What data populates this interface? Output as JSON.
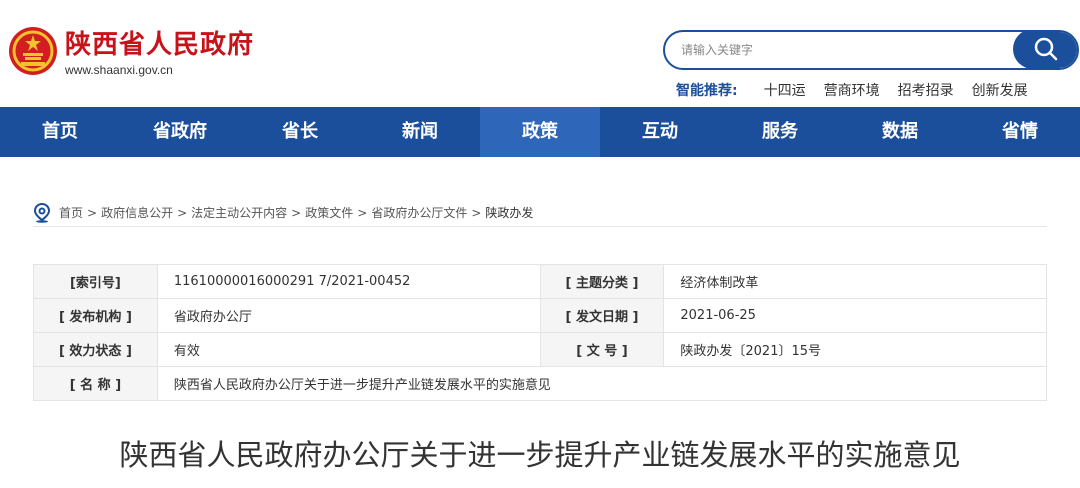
{
  "header": {
    "site_name": "陕西省人民政府",
    "site_url": "www.shaanxi.gov.cn",
    "search_placeholder": "请输入关键字",
    "recommend_label": "智能推荐:",
    "recommend_items": [
      "十四运",
      "营商环境",
      "招考招录",
      "创新发展"
    ]
  },
  "nav": {
    "items": [
      "首页",
      "省政府",
      "省长",
      "新闻",
      "政策",
      "互动",
      "服务",
      "数据",
      "省情"
    ],
    "active": "政策"
  },
  "breadcrumb": [
    "首页",
    "政府信息公开",
    "法定主动公开内容",
    "政策文件",
    "省政府办公厅文件",
    "陕政办发"
  ],
  "info": {
    "index_no_label": "[索引号]",
    "index_no": "11610000016000291 7/2021-00452",
    "category_label": "[ 主题分类 ]",
    "category": "经济体制改革",
    "issuer_label": "[ 发布机构 ]",
    "issuer": "省政府办公厅",
    "date_label": "[ 发文日期 ]",
    "date": "2021-06-25",
    "status_label": "[ 效力状态 ]",
    "status": "有效",
    "doc_no_label": "[ 文 号 ]",
    "doc_no": "陕政办发〔2021〕15号",
    "name_label": "[ 名 称 ]",
    "name": "陕西省人民政府办公厅关于进一步提升产业链发展水平的实施意见"
  },
  "document": {
    "title": "陕西省人民政府办公厅关于进一步提升产业链发展水平的实施意见"
  },
  "colors": {
    "brand_red": "#c8121a",
    "nav_blue": "#1b4f9c",
    "nav_active": "#2e67ba"
  }
}
